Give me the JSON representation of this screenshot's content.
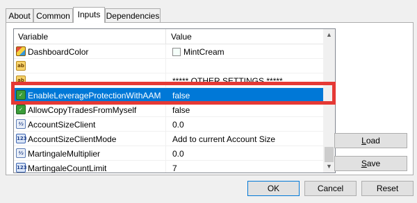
{
  "tabs": [
    {
      "label": "About"
    },
    {
      "label": "Common"
    },
    {
      "label": "Inputs"
    },
    {
      "label": "Dependencies"
    }
  ],
  "grid": {
    "columns": {
      "variable": "Variable",
      "value": "Value"
    },
    "rows": [
      {
        "icon": "color-icon",
        "variable": "DashboardColor",
        "value": "MintCream"
      },
      {
        "icon": "string-icon",
        "variable": "",
        "value": ""
      },
      {
        "icon": "string-icon",
        "variable": "",
        "value": "***** OTHER SETTINGS *****"
      },
      {
        "icon": "bool-icon",
        "variable": "EnableLeverageProtectionWithAAM",
        "value": "false"
      },
      {
        "icon": "bool-icon",
        "variable": "AllowCopyTradesFromMyself",
        "value": "false"
      },
      {
        "icon": "double-icon",
        "variable": "AccountSizeClient",
        "value": "0.0"
      },
      {
        "icon": "int-icon",
        "variable": "AccountSizeClientMode",
        "value": "Add to current Account Size"
      },
      {
        "icon": "double-icon",
        "variable": "MartingaleMultiplier",
        "value": "0.0"
      },
      {
        "icon": "int-icon",
        "variable": "MartingaleCountLimit",
        "value": "7"
      }
    ],
    "icon_text": {
      "string": "ab",
      "double": "½",
      "int": "123"
    }
  },
  "buttons": {
    "load_rest": "oad",
    "load_key": "L",
    "save_rest": "ave",
    "save_key": "S",
    "ok": "OK",
    "cancel": "Cancel",
    "reset": "Reset"
  },
  "colors": {
    "selection": "#0078d7",
    "highlight": "#e53935"
  }
}
